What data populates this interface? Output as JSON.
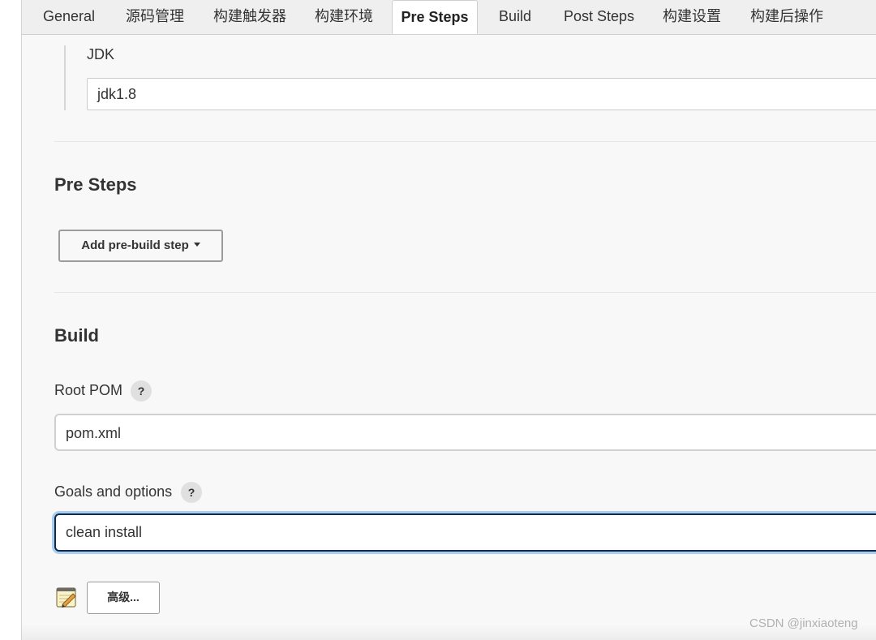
{
  "tabs": [
    {
      "label": "General"
    },
    {
      "label": "源码管理"
    },
    {
      "label": "构建触发器"
    },
    {
      "label": "构建环境"
    },
    {
      "label": "Pre Steps",
      "active": true
    },
    {
      "label": "Build"
    },
    {
      "label": "Post Steps"
    },
    {
      "label": "构建设置"
    },
    {
      "label": "构建后操作"
    }
  ],
  "jdk": {
    "label": "JDK",
    "value": "jdk1.8"
  },
  "pre_steps": {
    "title": "Pre Steps",
    "add_button": "Add pre-build step"
  },
  "build": {
    "title": "Build",
    "root_pom_label": "Root POM",
    "root_pom_value": "pom.xml",
    "goals_label": "Goals and options",
    "goals_value": "clean install",
    "help_symbol": "?",
    "advanced_button": "高级...",
    "notepad_icon": "notepad-icon"
  },
  "watermark": "CSDN @jinxiaoteng",
  "colors": {
    "focus_border": "#0d2a52",
    "focus_glow": "#a9cdec"
  }
}
